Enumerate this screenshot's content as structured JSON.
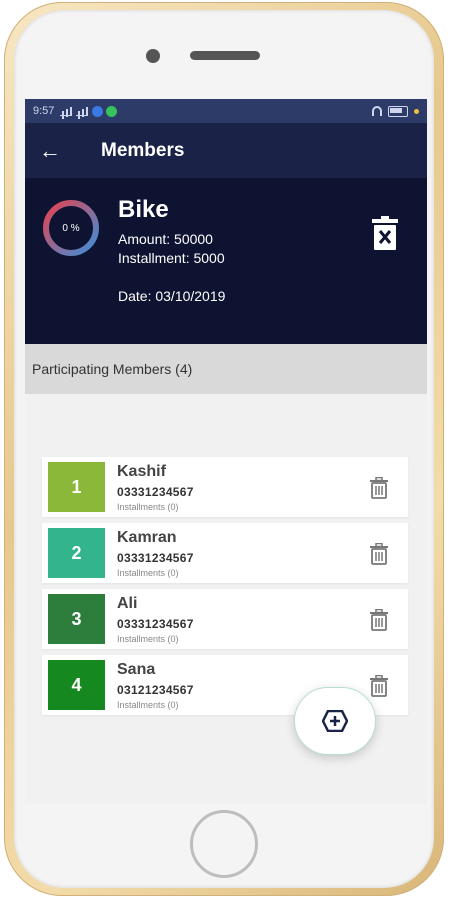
{
  "status_bar": {
    "time": "9:57"
  },
  "app_bar": {
    "title": "Members",
    "back_icon": "arrow-left-icon"
  },
  "plan": {
    "name": "Bike",
    "progress_label": "0 %",
    "progress_fraction": 0,
    "amount": "Amount: 50000",
    "installment": "Installment: 5000",
    "date": "Date: 03/10/2019",
    "delete_icon": "trash-x-icon"
  },
  "section": {
    "title": "Participating Members (4)"
  },
  "members": [
    {
      "num": "1",
      "name": "Kashif",
      "phone": "03331234567",
      "installments": "Installments (0)",
      "color": "#8bb838"
    },
    {
      "num": "2",
      "name": "Kamran",
      "phone": "03331234567",
      "installments": "Installments (0)",
      "color": "#33b48d"
    },
    {
      "num": "3",
      "name": "Ali",
      "phone": "03331234567",
      "installments": "Installments (0)",
      "color": "#2d7d3c"
    },
    {
      "num": "4",
      "name": "Sana",
      "phone": "03121234567",
      "installments": "Installments (0)",
      "color": "#15891f"
    }
  ],
  "fab": {
    "icon": "add-hexagon-icon"
  },
  "colors": {
    "appbar": "#1a2347",
    "summary": "#0d1330",
    "ring_start": "#e7424f",
    "ring_end": "#3c8fd9"
  }
}
